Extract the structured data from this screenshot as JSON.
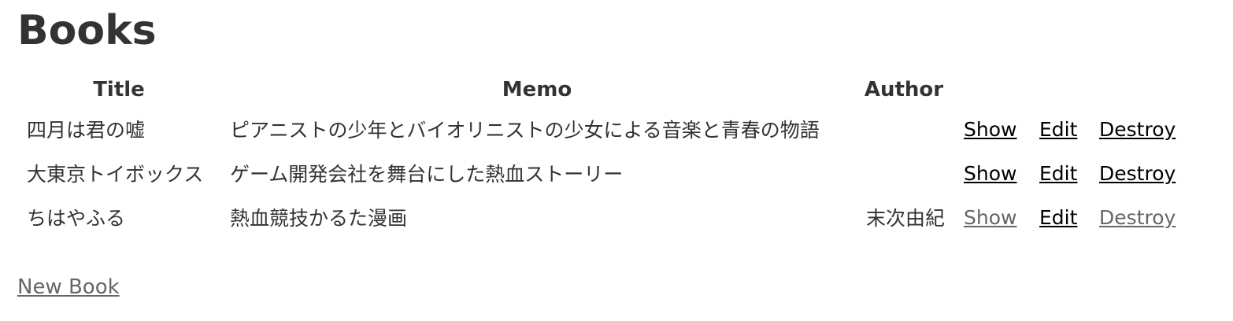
{
  "page": {
    "title": "Books"
  },
  "table": {
    "headers": {
      "title": "Title",
      "memo": "Memo",
      "author": "Author"
    },
    "rows": [
      {
        "title": "四月は君の嘘",
        "memo": "ピアニストの少年とバイオリニストの少女による音楽と青春の物語",
        "author": "",
        "show": "Show",
        "edit": "Edit",
        "destroy": "Destroy"
      },
      {
        "title": "大東京トイボックス",
        "memo": "ゲーム開発会社を舞台にした熱血ストーリー",
        "author": "",
        "show": "Show",
        "edit": "Edit",
        "destroy": "Destroy"
      },
      {
        "title": "ちはやふる",
        "memo": "熱血競技かるた漫画",
        "author": "末次由紀",
        "show": "Show",
        "edit": "Edit",
        "destroy": "Destroy"
      }
    ]
  },
  "actions": {
    "new_book": "New Book"
  },
  "colors": {
    "text": "#333333",
    "link": "#000000",
    "visited_link": "#666666",
    "background": "#ffffff"
  }
}
